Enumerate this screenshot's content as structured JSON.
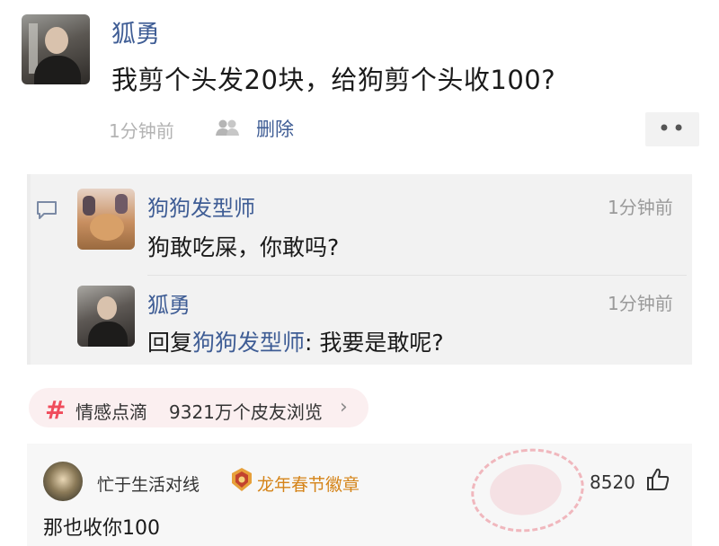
{
  "post": {
    "author": "狐勇",
    "text": "我剪个头发20块，给狗剪个头收100?",
    "time": "1分钟前",
    "delete_label": "删除",
    "more_label": "••"
  },
  "replies": [
    {
      "author": "狗狗发型师",
      "time": "1分钟前",
      "text": "狗敢吃屎，你敢吗?"
    },
    {
      "author": "狐勇",
      "time": "1分钟前",
      "reply_prefix": "回复",
      "reply_to": "狗狗发型师",
      "text": ": 我要是敢呢?"
    }
  ],
  "topic": {
    "hash": "#",
    "name": "情感点滴",
    "views": "9321万个皮友浏览",
    "chevron": "›"
  },
  "comment": {
    "author": "忙于生活对线",
    "badge": "龙年春节徽章",
    "likes": "8520",
    "text": "那也收你100"
  },
  "colors": {
    "link_blue": "#3f5d95",
    "topic_red": "#f04b5b",
    "badge_orange": "#d58419",
    "reply_bg": "#f2f2f2"
  },
  "icons": [
    "people-icon",
    "comment-icon",
    "hash-icon",
    "chevron-right-icon",
    "badge-icon",
    "thumb-up-icon"
  ]
}
